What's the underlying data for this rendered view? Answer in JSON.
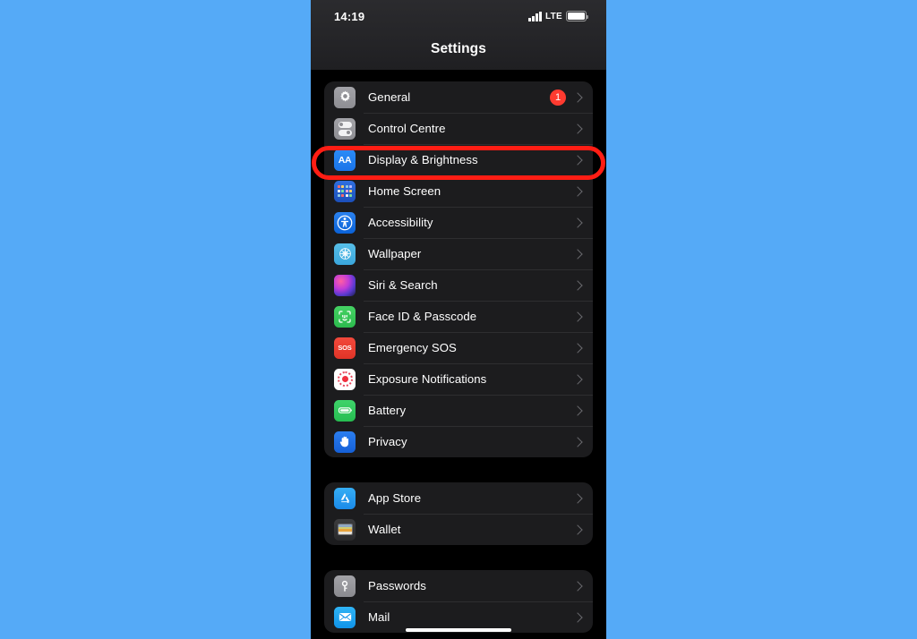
{
  "colors": {
    "background": "#55aaf7",
    "screen_bg": "#000000",
    "group_bg": "#1c1c1e",
    "accent_red": "#ff3b30",
    "highlight_red": "#ff1d14",
    "label": "#ffffff",
    "chevron": "#6a6a6e"
  },
  "status_bar": {
    "time": "14:19",
    "carrier_network": "LTE",
    "signal_icon": "signal-bars-icon",
    "battery_icon": "battery-full-icon"
  },
  "nav": {
    "title": "Settings"
  },
  "annotation": {
    "type": "highlight-box",
    "target_label": "Display & Brightness",
    "color": "#ff1d14"
  },
  "groups": [
    {
      "id": "system-group",
      "rows": [
        {
          "label": "General",
          "icon": "gear-icon",
          "badge": "1",
          "chevron": true
        },
        {
          "label": "Control Centre",
          "icon": "control-centre-icon",
          "badge": null,
          "chevron": true
        },
        {
          "label": "Display & Brightness",
          "icon": "display-brightness-aa-icon",
          "badge": null,
          "chevron": true,
          "highlighted": true
        },
        {
          "label": "Home Screen",
          "icon": "home-screen-grid-icon",
          "badge": null,
          "chevron": true
        },
        {
          "label": "Accessibility",
          "icon": "accessibility-person-icon",
          "badge": null,
          "chevron": true
        },
        {
          "label": "Wallpaper",
          "icon": "wallpaper-flower-icon",
          "badge": null,
          "chevron": true
        },
        {
          "label": "Siri & Search",
          "icon": "siri-orb-icon",
          "badge": null,
          "chevron": true
        },
        {
          "label": "Face ID & Passcode",
          "icon": "face-id-icon",
          "badge": null,
          "chevron": true
        },
        {
          "label": "Emergency SOS",
          "icon": "sos-icon",
          "badge": null,
          "chevron": true
        },
        {
          "label": "Exposure Notifications",
          "icon": "exposure-notifications-icon",
          "badge": null,
          "chevron": true
        },
        {
          "label": "Battery",
          "icon": "battery-icon",
          "badge": null,
          "chevron": true
        },
        {
          "label": "Privacy",
          "icon": "privacy-hand-icon",
          "badge": null,
          "chevron": true
        }
      ]
    },
    {
      "id": "store-group",
      "rows": [
        {
          "label": "App Store",
          "icon": "app-store-icon",
          "badge": null,
          "chevron": true
        },
        {
          "label": "Wallet",
          "icon": "wallet-icon",
          "badge": null,
          "chevron": true
        }
      ]
    },
    {
      "id": "accounts-group",
      "rows": [
        {
          "label": "Passwords",
          "icon": "passwords-key-icon",
          "badge": null,
          "chevron": true
        },
        {
          "label": "Mail",
          "icon": "mail-envelope-icon",
          "badge": null,
          "chevron": true
        }
      ]
    }
  ]
}
